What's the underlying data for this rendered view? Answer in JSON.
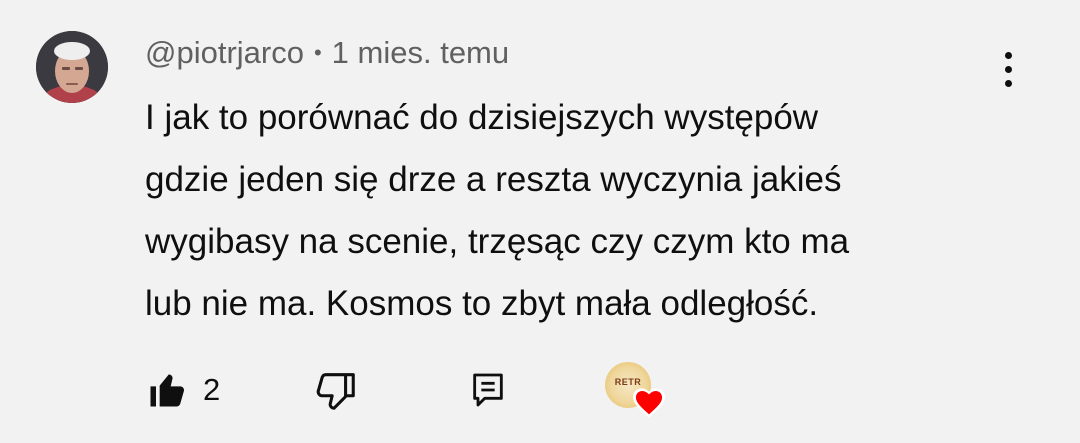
{
  "comment": {
    "author": "@piotrjarco",
    "separator": "•",
    "time": "1 mies. temu",
    "text": "I jak to porównać do dzisiejszych występów\ngdzie jeden się drze a reszta wyczynia jakieś\nwygibasy na scenie, trzęsąc czy czym kto ma\nlub nie ma.   Kosmos to zbyt mała odległość.",
    "like_count": "2"
  },
  "creator_heart": {
    "avatar_text": "RETR",
    "heart_color": "#ff0000"
  },
  "icons": {
    "menu": "more-vert-icon",
    "like": "thumb-up-filled-icon",
    "dislike": "thumb-down-outline-icon",
    "reply": "comment-reply-icon",
    "heart": "heart-icon"
  }
}
